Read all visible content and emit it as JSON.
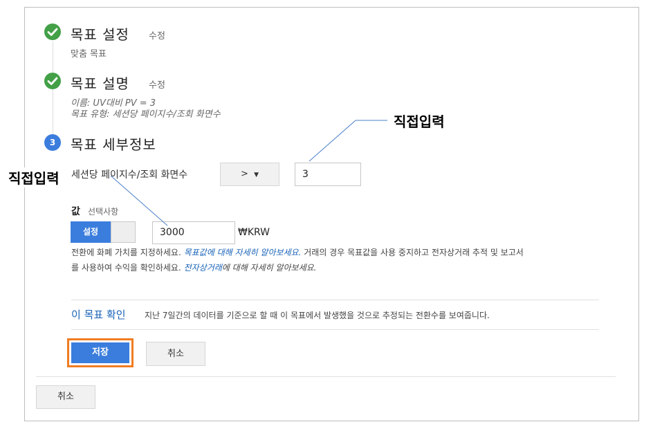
{
  "steps": [
    {
      "title": "목표 설정",
      "edit": "수정",
      "detail": "맞춤 목표"
    },
    {
      "title": "목표 설명",
      "edit": "수정",
      "detail_name": "이름: UV대비 PV = 3",
      "detail_type": "목표 유형: 세션당 페이지수/조회 화면수"
    },
    {
      "number": "3",
      "title": "목표 세부정보"
    }
  ],
  "condition": {
    "label": "세션당 페이지수/조회 화면수",
    "operator": ">",
    "value": "3"
  },
  "value_section": {
    "label": "값",
    "optional": "선택사항",
    "toggle_label": "설정",
    "amount": "3000",
    "currency": "₩KRW",
    "help_1a": "전환에 화폐 가치를 지정하세요. ",
    "help_link1": "목표값에 대해 자세히 알아보세요.",
    "help_1b": " 거래의 경우 목표값을 사용 중지하고 전자상거래 추적 및 보고서",
    "help_2a": "를 사용하여 수익을 확인하세요. ",
    "help_link2": "전자상거래",
    "help_2b": "에 대해 자세히 알아보세요."
  },
  "verify": {
    "link": "이 목표 확인",
    "description": "지난 7일간의 데이터를 기준으로 할 때 이 목표에서 발생했을 것으로 추정되는 전환수를 보여줍니다."
  },
  "buttons": {
    "save": "저장",
    "cancel_inner": "취소",
    "cancel_outer": "취소"
  },
  "annotations": {
    "right": "직접입력",
    "left": "직접입력"
  },
  "colors": {
    "accent_blue": "#3b7ddd",
    "check_green": "#43a047",
    "highlight_orange": "#f07c22"
  }
}
